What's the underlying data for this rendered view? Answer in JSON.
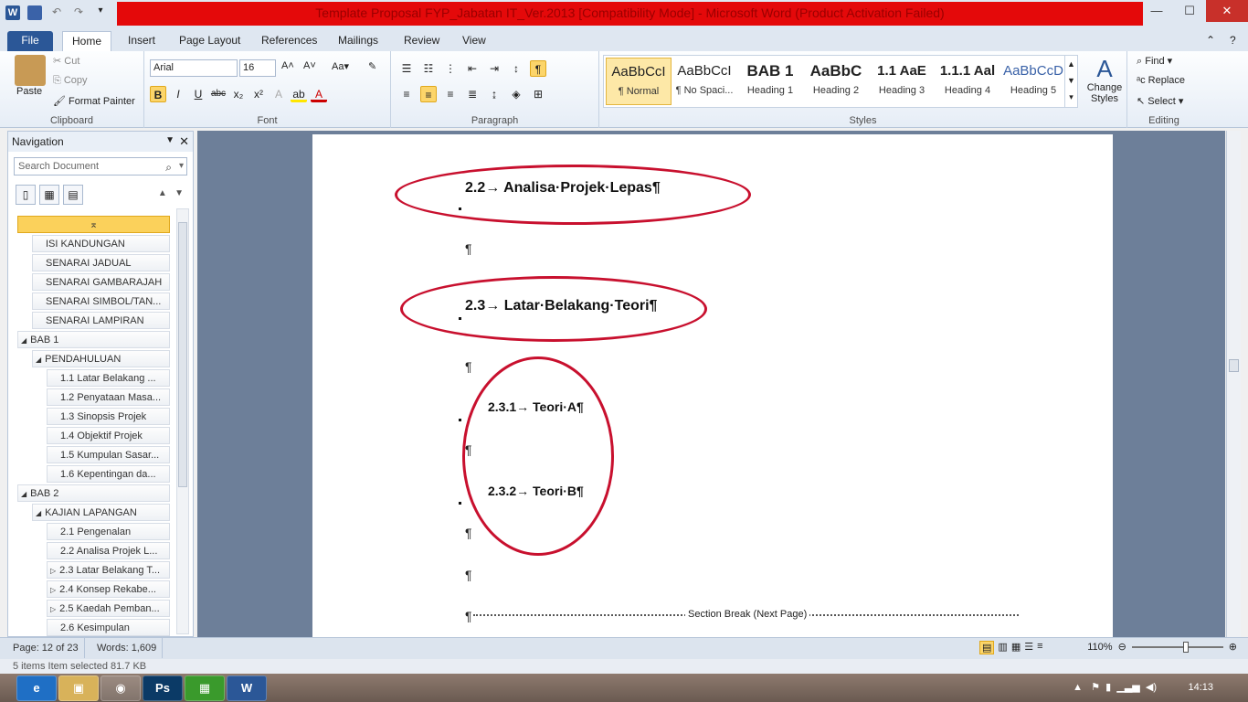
{
  "window": {
    "title": "Template Proposal FYP_Jabatan IT_Ver.2013 [Compatibility Mode] - Microsoft Word (Product Activation Failed)"
  },
  "ribbon_tabs": [
    "File",
    "Home",
    "Insert",
    "Page Layout",
    "References",
    "Mailings",
    "Review",
    "View"
  ],
  "clipboard": {
    "paste": "Paste",
    "cut": "Cut",
    "copy": "Copy",
    "format_painter": "Format Painter",
    "label": "Clipboard"
  },
  "font": {
    "name": "Arial",
    "size": "16",
    "label": "Font"
  },
  "paragraph": {
    "label": "Paragraph"
  },
  "styles": {
    "label": "Styles",
    "items": [
      {
        "preview": "AaBbCcI",
        "name": "¶ Normal"
      },
      {
        "preview": "AaBbCcI",
        "name": "¶ No Spaci..."
      },
      {
        "preview": "BAB 1",
        "name": "Heading 1"
      },
      {
        "preview": "AaBbC",
        "name": "Heading 2"
      },
      {
        "preview": "1.1 AaE",
        "name": "Heading 3"
      },
      {
        "preview": "1.1.1 Aal",
        "name": "Heading 4"
      },
      {
        "preview": "AaBbCcD",
        "name": "Heading 5"
      }
    ],
    "change_styles": "Change Styles"
  },
  "editing": {
    "find": "Find",
    "replace": "Replace",
    "select": "Select",
    "label": "Editing"
  },
  "navigation": {
    "title": "Navigation",
    "search_placeholder": "Search Document",
    "items": [
      {
        "label": "",
        "level": 0,
        "top": true
      },
      {
        "label": "ISI KANDUNGAN",
        "level": 1
      },
      {
        "label": "SENARAI JADUAL",
        "level": 1
      },
      {
        "label": "SENARAI GAMBARAJAH",
        "level": 1
      },
      {
        "label": "SENARAI SIMBOL/TAN...",
        "level": 1
      },
      {
        "label": "SENARAI LAMPIRAN",
        "level": 1
      },
      {
        "label": "BAB 1",
        "level": 0,
        "expander": "◢"
      },
      {
        "label": "PENDAHULUAN",
        "level": 1,
        "expander": "◢"
      },
      {
        "label": "1.1 Latar Belakang ...",
        "level": 2
      },
      {
        "label": "1.2 Penyataan Masa...",
        "level": 2
      },
      {
        "label": "1.3 Sinopsis Projek",
        "level": 2
      },
      {
        "label": "1.4 Objektif Projek",
        "level": 2
      },
      {
        "label": "1.5 Kumpulan Sasar...",
        "level": 2
      },
      {
        "label": "1.6 Kepentingan da...",
        "level": 2
      },
      {
        "label": "BAB 2",
        "level": 0,
        "expander": "◢"
      },
      {
        "label": "KAJIAN LAPANGAN",
        "level": 1,
        "expander": "◢"
      },
      {
        "label": "2.1 Pengenalan",
        "level": 2
      },
      {
        "label": "2.2 Analisa Projek L...",
        "level": 2
      },
      {
        "label": "2.3 Latar Belakang T...",
        "level": 2,
        "expander": "▷"
      },
      {
        "label": "2.4 Konsep Rekabe...",
        "level": 2,
        "expander": "▷"
      },
      {
        "label": "2.5 Kaedah Pemban...",
        "level": 2,
        "expander": "▷"
      },
      {
        "label": "2.6 Kesimpulan",
        "level": 2
      }
    ]
  },
  "document": {
    "h22": "2.2→ Analisa·Projek·Lepas¶",
    "h23": "2.3→ Latar·Belakang·Teori¶",
    "h231": "2.3.1→ Teori·A¶",
    "h232": "2.3.2→ Teori·B¶",
    "pilcrow": "¶",
    "section_break": "Section Break (Next Page)"
  },
  "status": {
    "page": "Page: 12 of 23",
    "words": "Words: 1,609",
    "zoom": "110%"
  },
  "explorer_strip": "5 items     Item selected  81.7 KB",
  "taskbar": {
    "clock": "14:13"
  },
  "colors": {
    "accent": "#2b5797",
    "title_red": "#e4090a",
    "ellipse": "#c8102e"
  }
}
